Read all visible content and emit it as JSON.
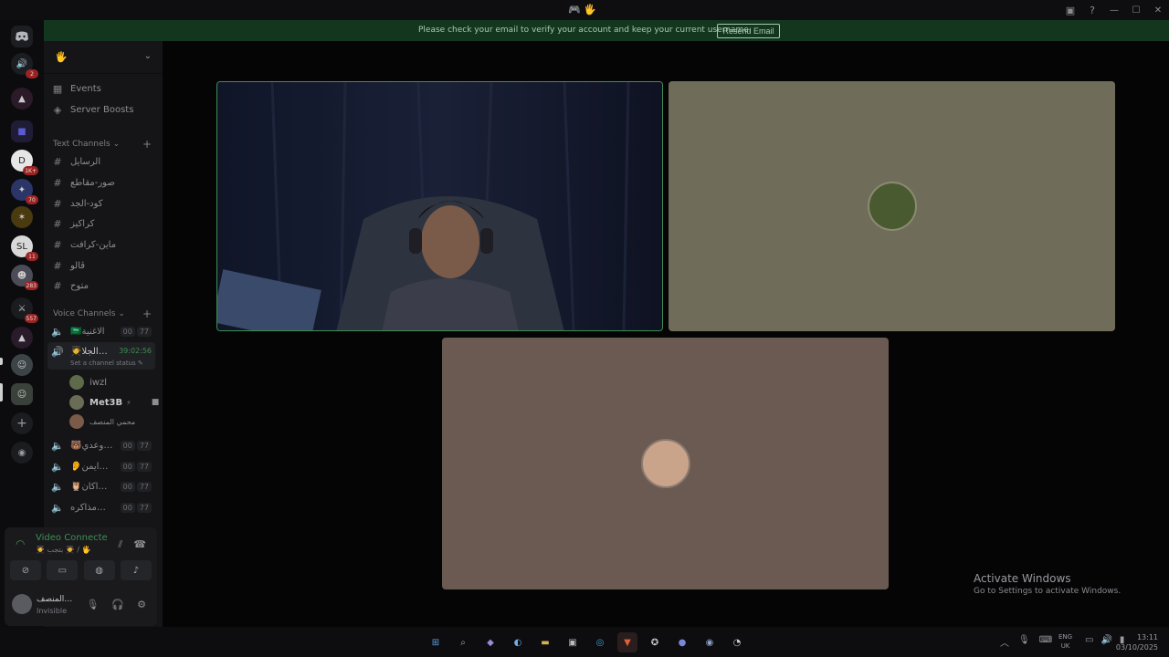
{
  "window": {
    "center_title": "🎮 🖐"
  },
  "banner": {
    "message": "Please check your email to verify your account and keep your current username.",
    "resend_label": "Resend Email"
  },
  "guilds": {
    "badges": [
      "2",
      "1K+",
      "70",
      "11",
      "283",
      "557"
    ]
  },
  "server": {
    "name": "🖐",
    "events": "Events",
    "boosts": "Server Boosts"
  },
  "text_channels": {
    "category": "Text Channels",
    "items": [
      "الرسايل",
      "صور-مقاطع",
      "كود-الجد",
      "كراكيز",
      "ماين-كرافت",
      "ڤالو",
      "متوح"
    ]
  },
  "voice_channels": {
    "category": "Voice Channels",
    "items": [
      {
        "name": "🇸🇦الاغنية",
        "count_a": "00",
        "count_b": "77"
      },
      {
        "name": "🧑‍🎓الجلا…",
        "timer": "39:02:56"
      },
      {
        "name": "🐻وعدي…",
        "count_a": "00",
        "count_b": "77"
      },
      {
        "name": "👂ايمن…",
        "count_a": "00",
        "count_b": "77"
      },
      {
        "name": "🦉اكان…",
        "count_a": "00",
        "count_b": "77"
      },
      {
        "name": "مذاكره…",
        "count_a": "00",
        "count_b": "77"
      }
    ],
    "set_status": "Set a channel status",
    "members": [
      "iwzl",
      "Met3B",
      "محمي المنصف"
    ]
  },
  "voice_box": {
    "status": "Video Connecte",
    "subtitle": "🧑‍🎓 بتجب 🧑‍🎓 / 🖐"
  },
  "user": {
    "name": "المنصف…",
    "status": "Invisible"
  },
  "activate": {
    "title": "Activate Windows",
    "subtitle": "Go to Settings to activate Windows."
  },
  "taskbar": {
    "lang_top": "ENG",
    "lang_bottom": "UK",
    "time": "13:11",
    "date": "03/10/2025"
  },
  "colors": {
    "banner": "#13361f",
    "accent_green": "#3e8e53",
    "video_border": "#3f8f55"
  }
}
